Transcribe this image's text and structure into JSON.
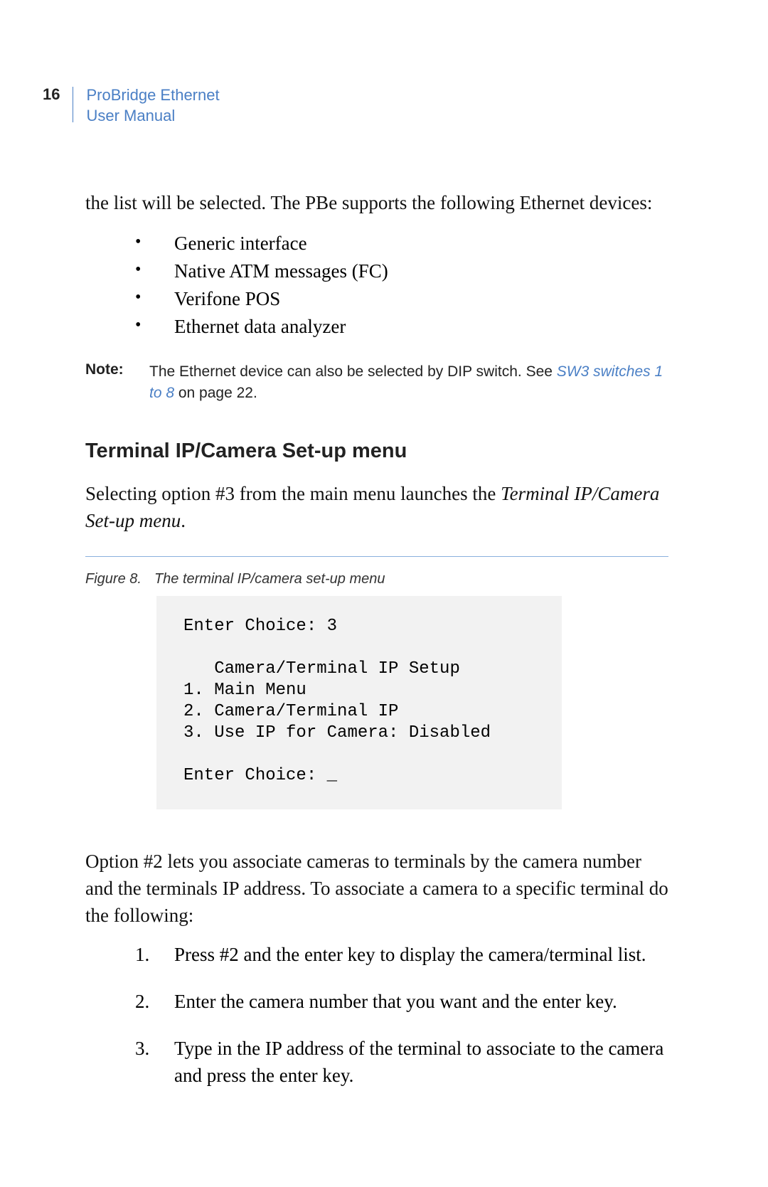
{
  "header": {
    "page_number": "16",
    "title_line1": "ProBridge Ethernet",
    "title_line2": "User Manual"
  },
  "intro_para": "the list will be selected. The PBe supports the following Ethernet devices:",
  "bullets": [
    "Generic interface",
    "Native ATM messages (FC)",
    "Verifone POS",
    "Ethernet data analyzer"
  ],
  "note": {
    "label": "Note:",
    "text_before": "The Ethernet device can also be selected by DIP switch. See  ",
    "link_text": "SW3 switches 1 to 8",
    "text_after": " on page 22."
  },
  "section_heading": "Terminal IP/Camera Set-up menu",
  "section_para_before": "Selecting option #3 from the main menu launches the ",
  "section_para_italic": "Terminal IP/Camera Set-up menu",
  "section_para_after": ".",
  "figure": {
    "label": "Figure 8.",
    "caption": "The terminal IP/camera set-up menu",
    "terminal_text": "Enter Choice: 3\n\n   Camera/Terminal IP Setup\n1. Main Menu\n2. Camera/Terminal IP\n3. Use IP for Camera: Disabled\n\nEnter Choice: _"
  },
  "option_para": "Option #2 lets you associate cameras to terminals by the camera number and the terminals IP address. To associate a camera to a specific terminal do the following:",
  "steps": [
    "Press #2 and the enter key to display the camera/terminal list.",
    "Enter the camera number that you want and the enter key.",
    "Type in the IP address of the terminal to associate to the camera and press the enter key."
  ]
}
